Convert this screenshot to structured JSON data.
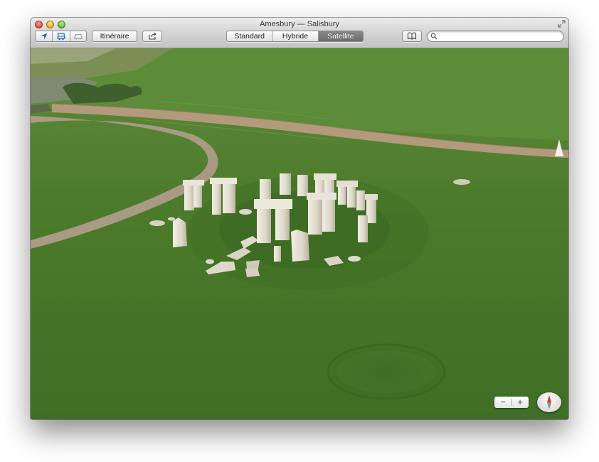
{
  "window": {
    "title": "Amesbury — Salisbury"
  },
  "toolbar": {
    "location_icon": "location-arrow-icon",
    "directions_icon": "bus-transit-icon",
    "traffic_icon": "car-icon",
    "itinerary_label": "Itinéraire",
    "share_icon": "share-icon",
    "map_modes": [
      {
        "label": "Standard",
        "active": false
      },
      {
        "label": "Hybride",
        "active": false
      },
      {
        "label": "Satellite",
        "active": true
      }
    ],
    "bookmarks_icon": "book-icon",
    "search": {
      "placeholder": "",
      "value": ""
    }
  },
  "map": {
    "view": "satellite-3d",
    "zoom_out_label": "−",
    "zoom_in_label": "+",
    "compass_icon": "compass-icon"
  },
  "colors": {
    "grass": "#4f7d2d",
    "path": "#a99a84",
    "stone": "#e6e2d6",
    "active_segment": "#767676"
  }
}
